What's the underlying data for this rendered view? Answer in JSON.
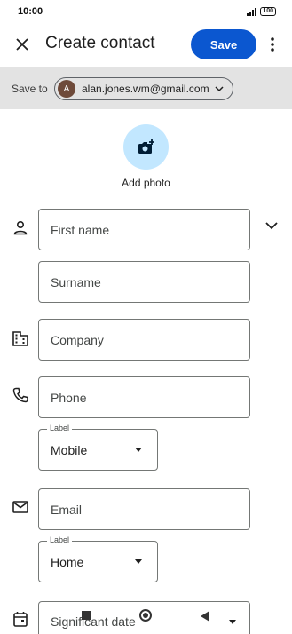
{
  "status_bar": {
    "time": "10:00",
    "battery": "100"
  },
  "header": {
    "title": "Create contact",
    "save_label": "Save"
  },
  "save_to": {
    "label": "Save to",
    "avatar_letter": "A",
    "email": "alan.jones.wm@gmail.com"
  },
  "photo": {
    "label": "Add photo"
  },
  "fields": {
    "first_name": {
      "placeholder": "First name"
    },
    "surname": {
      "placeholder": "Surname"
    },
    "company": {
      "placeholder": "Company"
    },
    "phone": {
      "placeholder": "Phone"
    },
    "phone_type": {
      "label": "Label",
      "value": "Mobile"
    },
    "email": {
      "placeholder": "Email"
    },
    "email_type": {
      "label": "Label",
      "value": "Home"
    },
    "significant_date": {
      "placeholder": "Significant date"
    }
  },
  "colors": {
    "primary": "#0b57d0",
    "avatar_bg": "#6e4a3a",
    "photo_circle": "#c2e7ff",
    "save_to_bar": "#e3e3e3"
  },
  "icons": [
    "close-icon",
    "more-vert-icon",
    "chevron-down-icon",
    "add-photo-icon",
    "person-icon",
    "company-icon",
    "phone-icon",
    "email-icon",
    "calendar-icon"
  ]
}
